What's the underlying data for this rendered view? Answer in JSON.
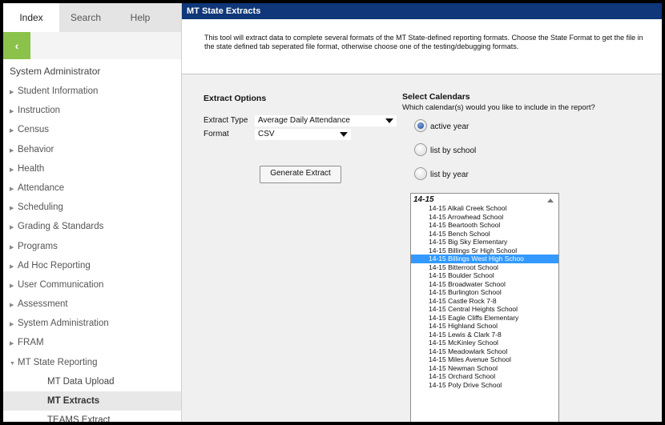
{
  "sidebar": {
    "tabs": [
      {
        "label": "Index"
      },
      {
        "label": "Search"
      },
      {
        "label": "Help"
      }
    ],
    "collapse_glyph": "‹",
    "role": "System Administrator",
    "items": [
      {
        "label": "Student Information",
        "arrow": "▶"
      },
      {
        "label": "Instruction",
        "arrow": "▶"
      },
      {
        "label": "Census",
        "arrow": "▶"
      },
      {
        "label": "Behavior",
        "arrow": "▶"
      },
      {
        "label": "Health",
        "arrow": "▶"
      },
      {
        "label": "Attendance",
        "arrow": "▶"
      },
      {
        "label": "Scheduling",
        "arrow": "▶"
      },
      {
        "label": "Grading & Standards",
        "arrow": "▶"
      },
      {
        "label": "Programs",
        "arrow": "▶"
      },
      {
        "label": "Ad Hoc Reporting",
        "arrow": "▶"
      },
      {
        "label": "User Communication",
        "arrow": "▶"
      },
      {
        "label": "Assessment",
        "arrow": "▶"
      },
      {
        "label": "System Administration",
        "arrow": "▶"
      },
      {
        "label": "FRAM",
        "arrow": "▶"
      },
      {
        "label": "MT State Reporting",
        "arrow": "▼"
      },
      {
        "label": "MT Data Upload",
        "arrow": ""
      },
      {
        "label": "MT Extracts",
        "arrow": ""
      },
      {
        "label": "TEAMS Extract",
        "arrow": ""
      }
    ]
  },
  "main": {
    "title": "MT State Extracts",
    "description": "This tool will extract data to complete several formats of the MT State-defined reporting formats. Choose the State Format to get the file in the state defined tab seperated file format, otherwise choose one of the testing/debugging formats.",
    "extract_options": {
      "heading": "Extract Options",
      "extract_type_label": "Extract Type",
      "extract_type_value": "Average Daily Attendance",
      "format_label": "Format",
      "format_value": "CSV",
      "generate_button": "Generate Extract"
    },
    "calendars": {
      "heading": "Select Calendars",
      "question": "Which calendar(s) would you like to include in the report?",
      "options": [
        {
          "label": "active year",
          "selected": true
        },
        {
          "label": "list by school",
          "selected": false
        },
        {
          "label": "list by year",
          "selected": false
        }
      ],
      "list_group": "14-15",
      "list_items": [
        "14-15 Alkali Creek School",
        "14-15 Arrowhead School",
        "14-15 Beartooth School",
        "14-15 Bench School",
        "14-15 Big Sky Elementary",
        "14-15 Billings Sr High School",
        "14-15 Billings West High Schoo",
        "14-15 Bitterroot School",
        "14-15 Boulder School",
        "14-15 Broadwater School",
        "14-15 Burlington School",
        "14-15 Castle Rock 7-8",
        "14-15 Central Heights School",
        "14-15 Eagle Cliffs Elementary",
        "14-15 Highland School",
        "14-15 Lewis & Clark 7-8",
        "14-15 McKinley School",
        "14-15 Meadowlark School",
        "14-15 Miles Avenue School",
        "14-15 Newman School",
        "14-15 Orchard School",
        "14-15 Poly Drive School"
      ],
      "selected_index": 6
    }
  }
}
